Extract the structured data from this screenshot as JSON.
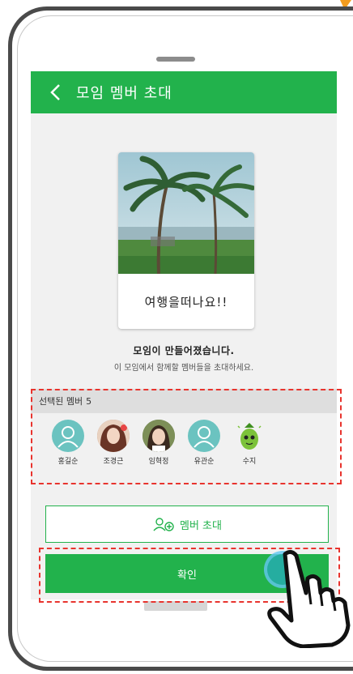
{
  "header": {
    "title": "모임 멤버 초대"
  },
  "card": {
    "title": "여행을떠나요!!"
  },
  "messages": {
    "created": "모임이 만들어졌습니다.",
    "hint": "이 모임에서 함께할 멤버들을 초대하세요."
  },
  "selected": {
    "label": "선택된 멤버",
    "count": "5",
    "members": [
      {
        "name": "홍길순",
        "avatar": "default-person"
      },
      {
        "name": "조경근",
        "avatar": "photo"
      },
      {
        "name": "임혁정",
        "avatar": "photo"
      },
      {
        "name": "유관순",
        "avatar": "default-person"
      },
      {
        "name": "수지",
        "avatar": "character"
      }
    ]
  },
  "buttons": {
    "invite": "멤버 초대",
    "confirm": "확인"
  },
  "colors": {
    "brand_green": "#22b24c",
    "highlight_red": "#e8342e",
    "avatar_teal": "#6bc3c0"
  }
}
